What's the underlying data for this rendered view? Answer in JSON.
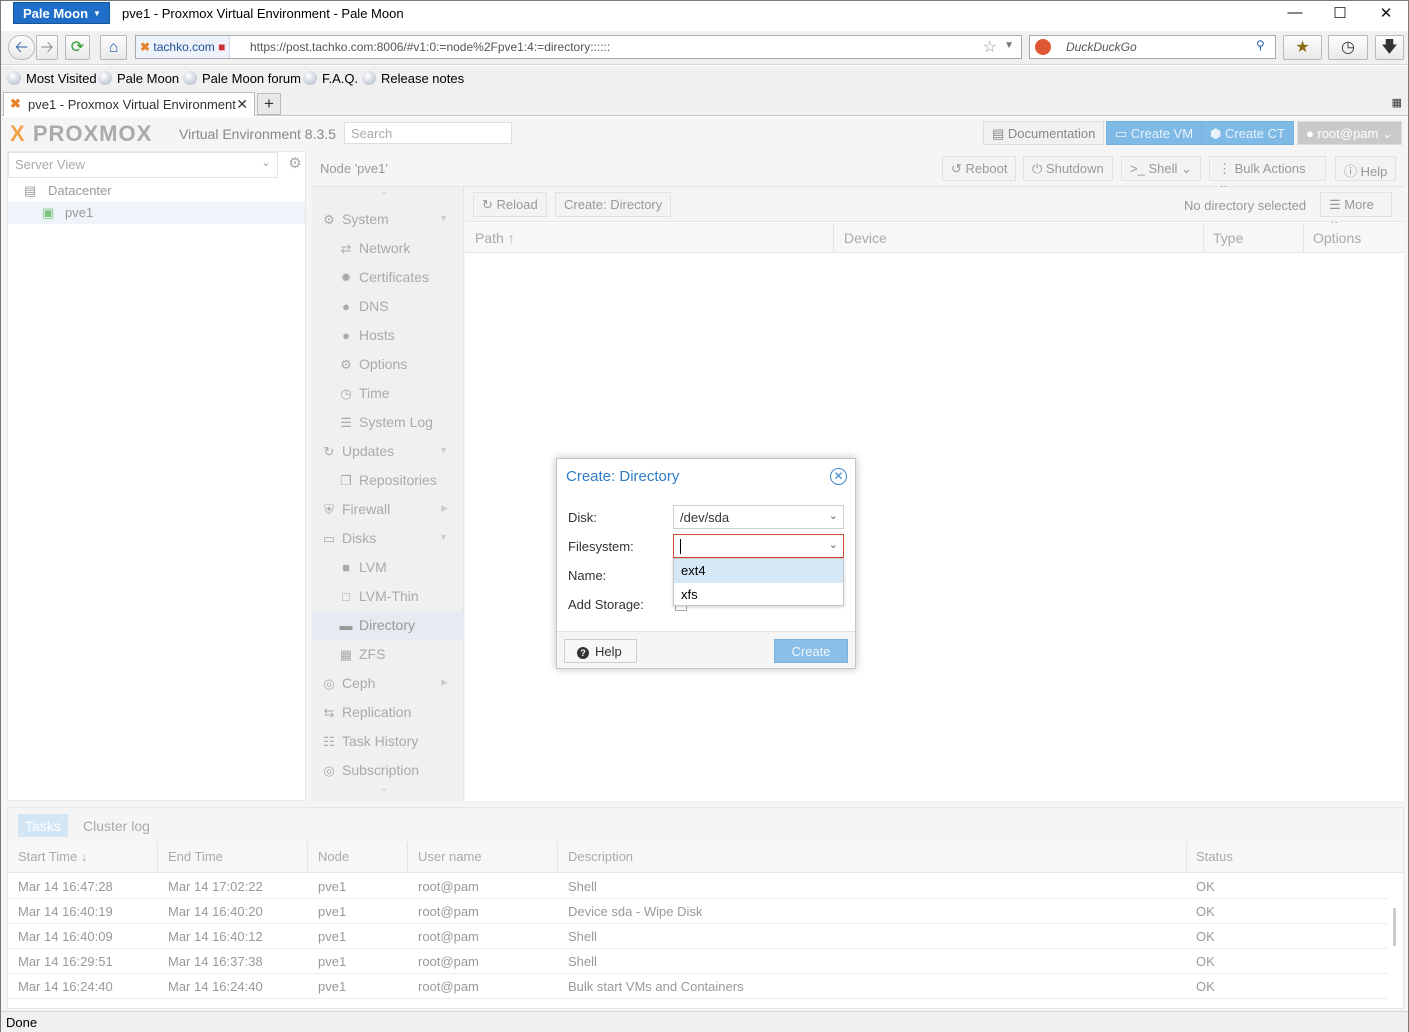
{
  "browser": {
    "app_button": "Pale Moon",
    "window_title": "pve1 - Proxmox Virtual Environment - Pale Moon",
    "identity": "tachko.com",
    "url": "https://post.tachko.com:8006/#v1:0:=node%2Fpve1:4:=directory::::::",
    "search_placeholder": "DuckDuckGo",
    "bookmarks": [
      "Most Visited",
      "Pale Moon",
      "Pale Moon forum",
      "F.A.Q.",
      "Release notes"
    ],
    "tab_title": "pve1 - Proxmox Virtual Environment",
    "status": "Done"
  },
  "pve": {
    "logo": "PROXMOX",
    "version": "Virtual Environment 8.3.5",
    "search_placeholder": "Search",
    "header_buttons": {
      "docs": "Documentation",
      "create_vm": "Create VM",
      "create_ct": "Create CT",
      "user": "root@pam"
    },
    "view_selector": "Server View",
    "tree": [
      "Datacenter",
      "pve1"
    ],
    "node_title": "Node 'pve1'",
    "node_buttons": {
      "reboot": "Reboot",
      "shutdown": "Shutdown",
      "shell": "Shell",
      "bulk": "Bulk Actions",
      "help": "Help"
    },
    "menu": [
      {
        "label": "System",
        "icon": "gears-icon",
        "sub": false,
        "arrow": true
      },
      {
        "label": "Network",
        "icon": "exchange-icon",
        "sub": true
      },
      {
        "label": "Certificates",
        "icon": "certificate-icon",
        "sub": true
      },
      {
        "label": "DNS",
        "icon": "globe-icon",
        "sub": true
      },
      {
        "label": "Hosts",
        "icon": "globe-icon",
        "sub": true
      },
      {
        "label": "Options",
        "icon": "gear-icon",
        "sub": true
      },
      {
        "label": "Time",
        "icon": "clock-icon",
        "sub": true
      },
      {
        "label": "System Log",
        "icon": "list-icon",
        "sub": true
      },
      {
        "label": "Updates",
        "icon": "refresh-icon",
        "sub": false,
        "arrow": true
      },
      {
        "label": "Repositories",
        "icon": "files-icon",
        "sub": true
      },
      {
        "label": "Firewall",
        "icon": "shield-icon",
        "sub": false,
        "arrow": true
      },
      {
        "label": "Disks",
        "icon": "hdd-icon",
        "sub": false,
        "arrow": true
      },
      {
        "label": "LVM",
        "icon": "square-icon",
        "sub": true
      },
      {
        "label": "LVM-Thin",
        "icon": "square-outline-icon",
        "sub": true
      },
      {
        "label": "Directory",
        "icon": "folder-icon",
        "sub": true,
        "selected": true
      },
      {
        "label": "ZFS",
        "icon": "th-large-icon",
        "sub": true
      },
      {
        "label": "Ceph",
        "icon": "ceph-icon",
        "sub": false,
        "arrow": true
      },
      {
        "label": "Replication",
        "icon": "retweet-icon",
        "sub": false
      },
      {
        "label": "Task History",
        "icon": "list-alt-icon",
        "sub": false
      },
      {
        "label": "Subscription",
        "icon": "support-icon",
        "sub": false
      }
    ],
    "grid": {
      "reload": "Reload",
      "create": "Create: Directory",
      "no_selection": "No directory selected",
      "more": "More",
      "columns": [
        "Path",
        "Device",
        "Type",
        "Options"
      ]
    },
    "tasks": {
      "tabs": [
        "Tasks",
        "Cluster log"
      ],
      "columns": [
        "Start Time",
        "End Time",
        "Node",
        "User name",
        "Description",
        "Status"
      ],
      "rows": [
        [
          "Mar 14 16:47:28",
          "Mar 14 17:02:22",
          "pve1",
          "root@pam",
          "Shell",
          "OK"
        ],
        [
          "Mar 14 16:40:19",
          "Mar 14 16:40:20",
          "pve1",
          "root@pam",
          "Device sda - Wipe Disk",
          "OK"
        ],
        [
          "Mar 14 16:40:09",
          "Mar 14 16:40:12",
          "pve1",
          "root@pam",
          "Shell",
          "OK"
        ],
        [
          "Mar 14 16:29:51",
          "Mar 14 16:37:38",
          "pve1",
          "root@pam",
          "Shell",
          "OK"
        ],
        [
          "Mar 14 16:24:40",
          "Mar 14 16:24:40",
          "pve1",
          "root@pam",
          "Bulk start VMs and Containers",
          "OK"
        ]
      ]
    }
  },
  "dialog": {
    "title": "Create: Directory",
    "labels": {
      "disk": "Disk:",
      "filesystem": "Filesystem:",
      "name": "Name:",
      "add_storage": "Add Storage:"
    },
    "disk_value": "/dev/sda",
    "filesystem_value": "",
    "filesystem_options": [
      "ext4",
      "xfs"
    ],
    "help": "Help",
    "create": "Create"
  }
}
